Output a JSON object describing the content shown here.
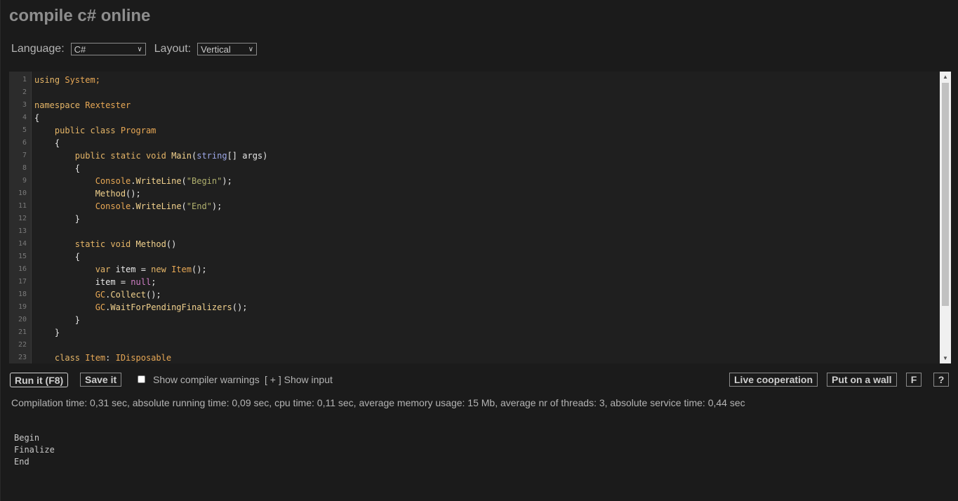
{
  "page": {
    "title": "compile c# online"
  },
  "options": {
    "language_label": "Language:",
    "language_value": "C#",
    "layout_label": "Layout:",
    "layout_value": "Vertical"
  },
  "editor": {
    "lines": [
      [
        {
          "t": "using",
          "c": "kw"
        },
        {
          "t": " System;",
          "c": "ty"
        }
      ],
      [],
      [
        {
          "t": "namespace",
          "c": "kw"
        },
        {
          "t": " Rextester",
          "c": "ty"
        }
      ],
      [
        {
          "t": "{"
        }
      ],
      [
        {
          "t": "    public class ",
          "c": "kw"
        },
        {
          "t": "Program",
          "c": "ty"
        }
      ],
      [
        {
          "t": "    {"
        }
      ],
      [
        {
          "t": "        public static void ",
          "c": "kw"
        },
        {
          "t": "Main",
          "c": "fn"
        },
        {
          "t": "("
        },
        {
          "t": "string",
          "c": "bt"
        },
        {
          "t": "[] args)"
        }
      ],
      [
        {
          "t": "        {"
        }
      ],
      [
        {
          "t": "            Console",
          "c": "ty"
        },
        {
          "t": "."
        },
        {
          "t": "WriteLine",
          "c": "fn"
        },
        {
          "t": "("
        },
        {
          "t": "\"Begin\"",
          "c": "st"
        },
        {
          "t": ");"
        }
      ],
      [
        {
          "t": "            Method",
          "c": "fn"
        },
        {
          "t": "();"
        }
      ],
      [
        {
          "t": "            Console",
          "c": "ty"
        },
        {
          "t": "."
        },
        {
          "t": "WriteLine",
          "c": "fn"
        },
        {
          "t": "("
        },
        {
          "t": "\"End\"",
          "c": "st"
        },
        {
          "t": ");"
        }
      ],
      [
        {
          "t": "        }"
        }
      ],
      [],
      [
        {
          "t": "        static void ",
          "c": "kw"
        },
        {
          "t": "Method",
          "c": "fn"
        },
        {
          "t": "()"
        }
      ],
      [
        {
          "t": "        {"
        }
      ],
      [
        {
          "t": "            var ",
          "c": "kw"
        },
        {
          "t": "item = "
        },
        {
          "t": "new ",
          "c": "kw"
        },
        {
          "t": "Item",
          "c": "ty"
        },
        {
          "t": "();"
        }
      ],
      [
        {
          "t": "            item = "
        },
        {
          "t": "null",
          "c": "nl"
        },
        {
          "t": ";"
        }
      ],
      [
        {
          "t": "            GC",
          "c": "ty"
        },
        {
          "t": "."
        },
        {
          "t": "Collect",
          "c": "fn"
        },
        {
          "t": "();"
        }
      ],
      [
        {
          "t": "            GC",
          "c": "ty"
        },
        {
          "t": "."
        },
        {
          "t": "WaitForPendingFinalizers",
          "c": "fn"
        },
        {
          "t": "();"
        }
      ],
      [
        {
          "t": "        }"
        }
      ],
      [
        {
          "t": "    }"
        }
      ],
      [],
      [
        {
          "t": "    class ",
          "c": "kw"
        },
        {
          "t": "Item",
          "c": "ty"
        },
        {
          "t": ": "
        },
        {
          "t": "IDisposable",
          "c": "ty"
        }
      ]
    ],
    "line_numbers": [
      "1",
      "2",
      "3",
      "4",
      "5",
      "6",
      "7",
      "8",
      "9",
      "10",
      "11",
      "12",
      "13",
      "14",
      "15",
      "16",
      "17",
      "18",
      "19",
      "20",
      "21",
      "22",
      "23"
    ],
    "scroll_fraction": 0.8
  },
  "toolbar": {
    "run_label": "Run it (F8)",
    "save_label": "Save it",
    "warnings_label": "Show compiler warnings",
    "show_input_label": "[ + ] Show input",
    "live_label": "Live cooperation",
    "wall_label": "Put on a wall",
    "f_label": "F",
    "help_label": "?"
  },
  "stats": "Compilation time: 0,31 sec, absolute running time: 0,09 sec, cpu time: 0,11 sec, average memory usage: 15 Mb, average nr of threads: 3, absolute service time: 0,44 sec",
  "output": [
    "Begin",
    "Finalize",
    "End"
  ],
  "icons": {
    "select_arrow": "chevron-down-icon",
    "scroll_up": "triangle-up-icon",
    "scroll_down": "triangle-down-icon"
  }
}
